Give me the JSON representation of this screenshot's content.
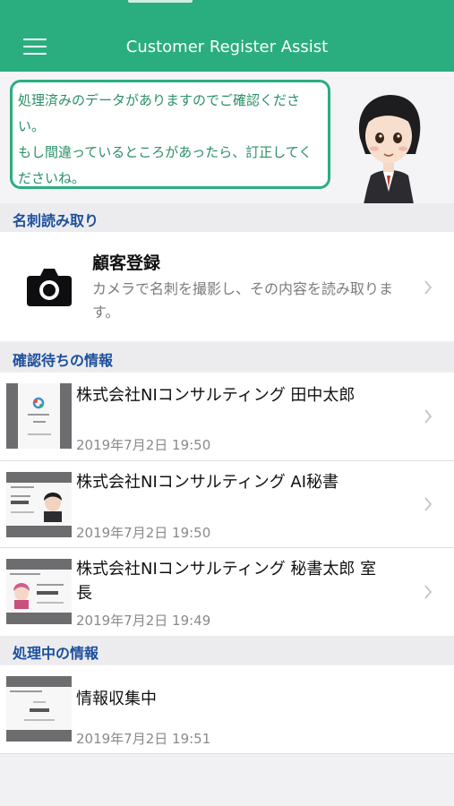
{
  "header": {
    "title": "Customer Register Assist"
  },
  "bubble": {
    "message": "処理済みのデータがありますのでご確認ください。\nもし間違っているところがあったら、訂正してくださいね。"
  },
  "sections": {
    "card_scan": "名刺読み取り",
    "pending": "確認待ちの情報",
    "processing": "処理中の情報"
  },
  "register": {
    "title": "顧客登録",
    "description": "カメラで名刺を撮影し、その内容を読み取ります。"
  },
  "pending_items": [
    {
      "title": "株式会社NIコンサルティング 田中太郎",
      "date": "2019年7月2日 19:50"
    },
    {
      "title": "株式会社NIコンサルティング AI秘書",
      "date": "2019年7月2日 19:50"
    },
    {
      "title": "株式会社NIコンサルティング 秘書太郎 室長",
      "date": "2019年7月2日 19:49"
    }
  ],
  "processing_items": [
    {
      "title": "情報収集中",
      "date": "2019年7月2日 19:51"
    }
  ],
  "colors": {
    "accent": "#2aae7f",
    "section_label": "#1d4f9c"
  },
  "icons": {
    "menu": "hamburger-icon",
    "camera": "camera-icon",
    "chevron": "chevron-right-icon"
  }
}
